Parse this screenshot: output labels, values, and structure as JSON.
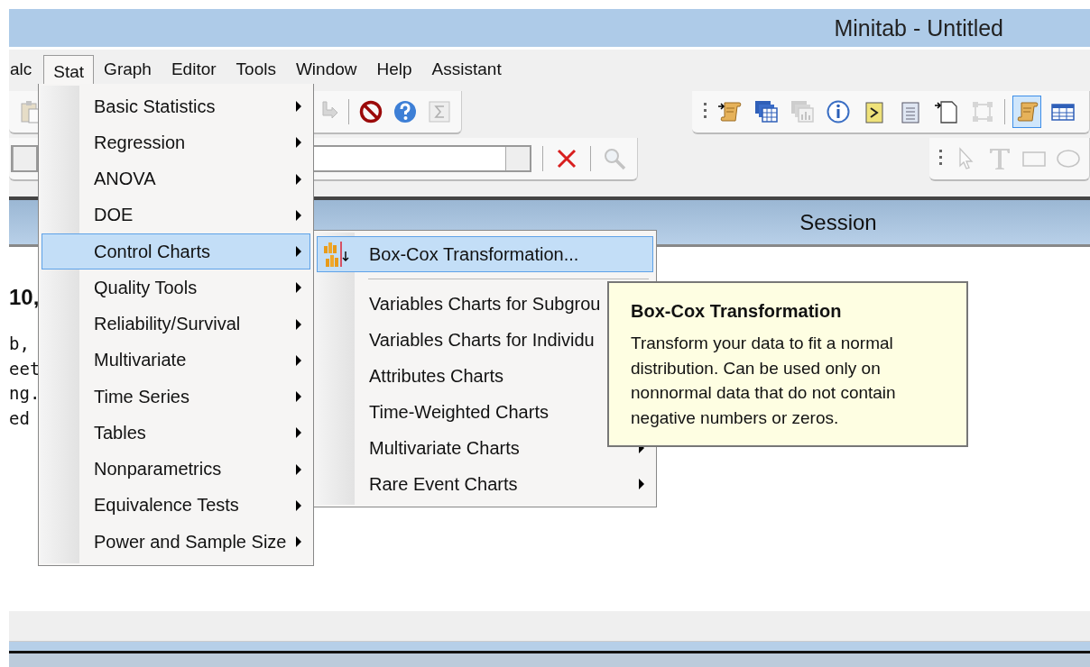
{
  "window": {
    "title": "Minitab - Untitled"
  },
  "menu_bar": [
    {
      "label": "alc",
      "selected": false
    },
    {
      "label": "Stat",
      "selected": true
    },
    {
      "label": "Graph",
      "selected": false
    },
    {
      "label": "Editor",
      "selected": false
    },
    {
      "label": "Tools",
      "selected": false
    },
    {
      "label": "Window",
      "selected": false
    },
    {
      "label": "Help",
      "selected": false
    },
    {
      "label": "Assistant",
      "selected": false
    }
  ],
  "toolbar_left": [
    {
      "kind": "clipboard",
      "disabled": true
    },
    {
      "kind": "gap"
    },
    {
      "kind": "arrow",
      "disabled": true
    },
    {
      "kind": "separator"
    },
    {
      "kind": "stop",
      "disabled": false
    },
    {
      "kind": "help",
      "disabled": false
    },
    {
      "kind": "sigma",
      "disabled": true
    }
  ],
  "toolbar_right": [
    {
      "kind": "grip"
    },
    {
      "kind": "script-in",
      "disabled": false,
      "selected": false
    },
    {
      "kind": "windows",
      "disabled": false,
      "selected": false
    },
    {
      "kind": "windows-chart",
      "disabled": true,
      "selected": false
    },
    {
      "kind": "info",
      "disabled": false,
      "selected": false
    },
    {
      "kind": "console",
      "disabled": false,
      "selected": false
    },
    {
      "kind": "notepad",
      "disabled": false,
      "selected": false
    },
    {
      "kind": "new-page",
      "disabled": false,
      "selected": false
    },
    {
      "kind": "nodes",
      "disabled": true,
      "selected": false
    },
    {
      "kind": "separator"
    },
    {
      "kind": "script",
      "disabled": false,
      "selected": true
    },
    {
      "kind": "table",
      "disabled": false,
      "selected": false
    }
  ],
  "toolbar_draw": [
    {
      "kind": "grip"
    },
    {
      "kind": "pointer",
      "disabled": true
    },
    {
      "kind": "text-tool",
      "disabled": true
    },
    {
      "kind": "rectangle",
      "disabled": true
    },
    {
      "kind": "ellipse",
      "disabled": true
    }
  ],
  "session": {
    "title": "Session",
    "heading": "10,",
    "lines": [
      "b,",
      "eet",
      "ng.",
      "ed"
    ]
  },
  "stat_menu": [
    {
      "label": "Basic Statistics",
      "selected": false,
      "submenu": true
    },
    {
      "label": "Regression",
      "selected": false,
      "submenu": true
    },
    {
      "label": "ANOVA",
      "selected": false,
      "submenu": true
    },
    {
      "label": "DOE",
      "selected": false,
      "submenu": true
    },
    {
      "label": "Control Charts",
      "selected": true,
      "submenu": true
    },
    {
      "label": "Quality Tools",
      "selected": false,
      "submenu": true
    },
    {
      "label": "Reliability/Survival",
      "selected": false,
      "submenu": true
    },
    {
      "label": "Multivariate",
      "selected": false,
      "submenu": true
    },
    {
      "label": "Time Series",
      "selected": false,
      "submenu": true
    },
    {
      "label": "Tables",
      "selected": false,
      "submenu": true
    },
    {
      "label": "Nonparametrics",
      "selected": false,
      "submenu": true
    },
    {
      "label": "Equivalence Tests",
      "selected": false,
      "submenu": true
    },
    {
      "label": "Power and Sample Size",
      "selected": false,
      "submenu": true
    }
  ],
  "control_charts_menu": [
    {
      "kind": "command",
      "label": "Box-Cox Transformation...",
      "selected": true,
      "icon": true
    },
    {
      "kind": "separator"
    },
    {
      "kind": "command",
      "label": "Variables Charts for Subgrou",
      "selected": false,
      "icon": false
    },
    {
      "kind": "command",
      "label": "Variables Charts for Individu",
      "selected": false,
      "icon": false
    },
    {
      "kind": "command",
      "label": "Attributes Charts",
      "selected": false,
      "icon": false
    },
    {
      "kind": "command",
      "label": "Time-Weighted Charts",
      "selected": false,
      "icon": false
    },
    {
      "kind": "submenu",
      "label": "Multivariate Charts",
      "selected": false,
      "icon": false
    },
    {
      "kind": "submenu",
      "label": "Rare Event Charts",
      "selected": false,
      "icon": false
    }
  ],
  "tooltip": {
    "title": "Box-Cox Transformation",
    "text": "Transform your data to fit a normal distribution. Can be used only on nonnormal data that do not contain negative numbers or zeros."
  }
}
